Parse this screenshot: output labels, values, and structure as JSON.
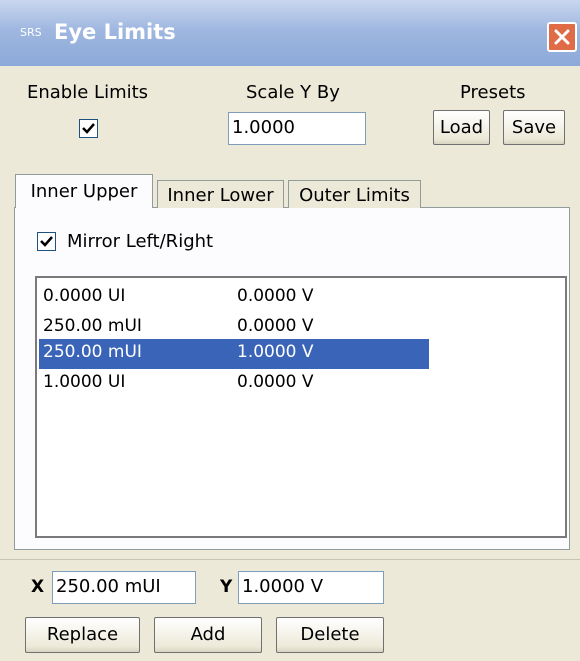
{
  "window": {
    "logo_text": "SRS",
    "title": "Eye Limits",
    "close_icon": "close-x-icon",
    "close_color": "#e06b47"
  },
  "top": {
    "enable_limits_label": "Enable Limits",
    "enable_limits_checked": true,
    "scale_label": "Scale Y By",
    "scale_value": "1.0000",
    "presets_label": "Presets",
    "load_label": "Load",
    "save_label": "Save"
  },
  "tabs": [
    {
      "label": "Inner Upper",
      "active": true
    },
    {
      "label": "Inner Lower",
      "active": false
    },
    {
      "label": "Outer Limits",
      "active": false
    }
  ],
  "mirror": {
    "label": "Mirror Left/Right",
    "checked": true
  },
  "points": [
    {
      "x": "0.0000 UI",
      "y": "0.0000 V",
      "selected": false
    },
    {
      "x": "250.00 mUI",
      "y": "0.0000 V",
      "selected": false
    },
    {
      "x": "250.00 mUI",
      "y": "1.0000 V",
      "selected": true
    },
    {
      "x": "1.0000 UI",
      "y": "0.0000 V",
      "selected": false
    }
  ],
  "edit": {
    "x_label": "X",
    "x_value": "250.00 mUI",
    "y_label": "Y",
    "y_value": "1.0000 V",
    "replace_label": "Replace",
    "add_label": "Add",
    "delete_label": "Delete"
  },
  "colors": {
    "selection": "#3a64b8",
    "titlebar": "#9fb7e0",
    "checkmark": "#21a121"
  }
}
